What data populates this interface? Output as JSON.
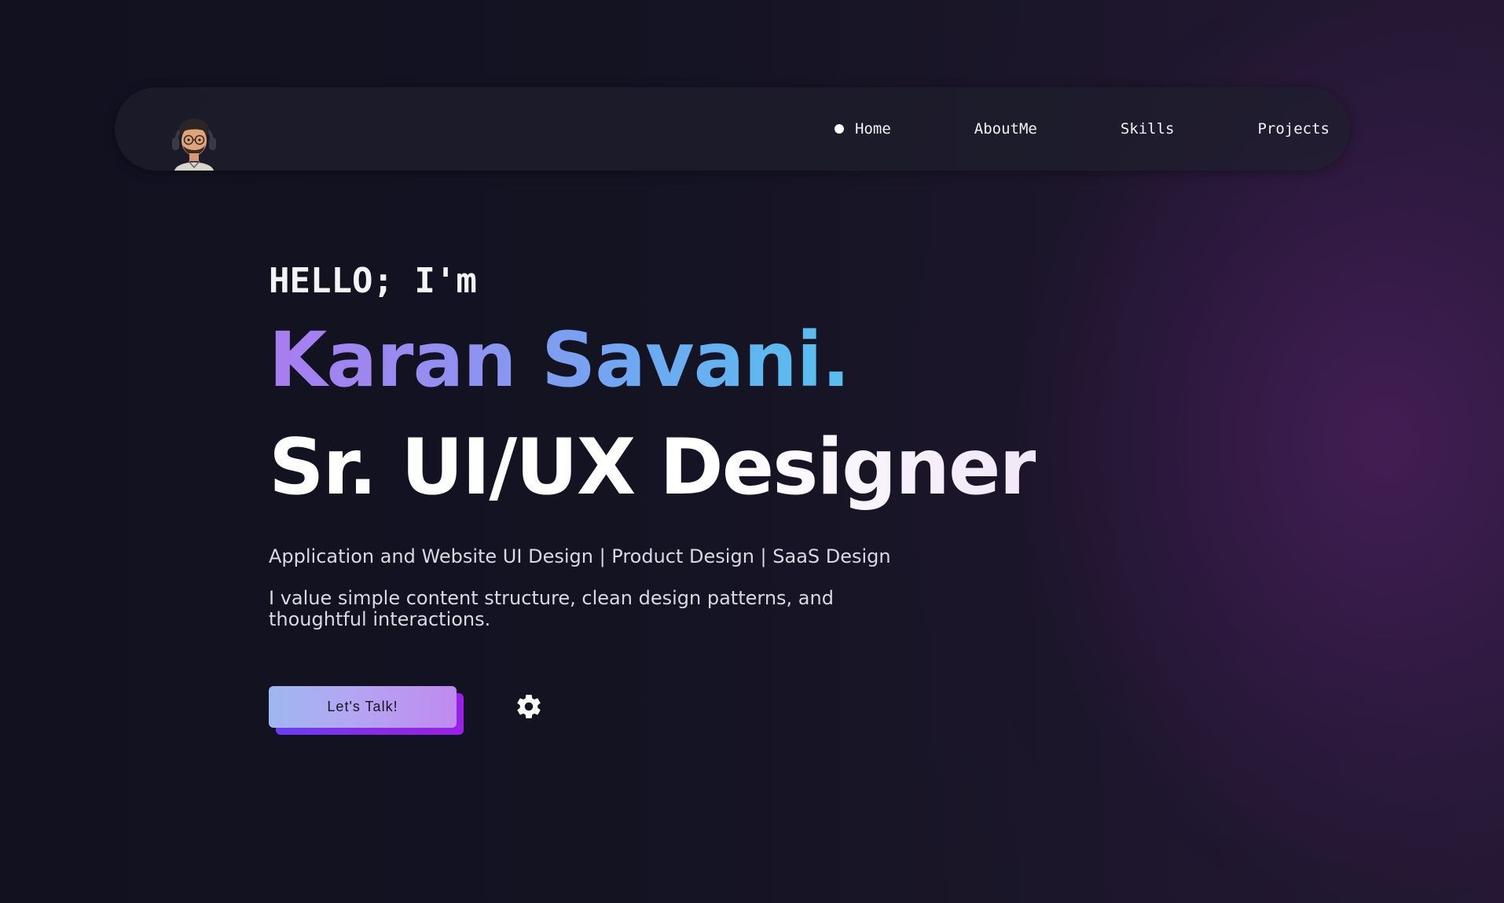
{
  "nav": {
    "avatar_icon": "avatar-memoji-icon",
    "items": [
      {
        "label": "Home",
        "active": true
      },
      {
        "label": "AboutMe",
        "active": false
      },
      {
        "label": "Skills",
        "active": false
      },
      {
        "label": "Projects",
        "active": false
      }
    ]
  },
  "hero": {
    "greeting": "HELLO; I'm",
    "name": "Karan Savani.",
    "role": "Sr. UI/UX Designer",
    "services": "Application and Website UI Design | Product Design | SaaS Design",
    "tagline": "I value simple content structure, clean design patterns, and thoughtful interactions."
  },
  "cta": {
    "label": "Let's Talk!",
    "settings_icon": "gear-icon"
  },
  "colors": {
    "background": "#121220",
    "accent_purple": "#8a2be2",
    "name_gradient_start": "#a97cf0",
    "name_gradient_end": "#56c0ee"
  }
}
